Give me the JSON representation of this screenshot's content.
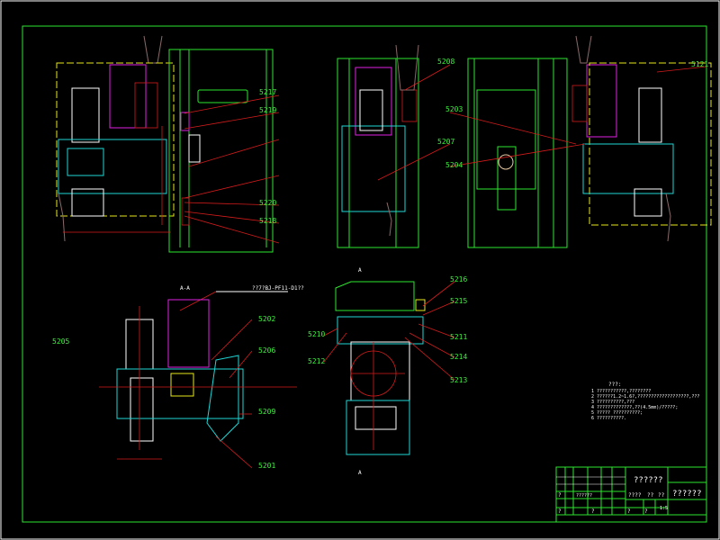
{
  "drawing": {
    "view_top_left_labels": [
      "5217",
      "5219",
      "5220",
      "5218"
    ],
    "view_top_mid_labels": [
      "5208",
      "5207"
    ],
    "view_top_right_labels": [
      "5203",
      "5204",
      "5121"
    ],
    "section_title": "A-A",
    "section_marker": "A",
    "motor_label": "??7?BJ-PF11-D1??",
    "section_left_labels": [
      "5202",
      "5206",
      "5205",
      "5201",
      "5209"
    ],
    "section_right_labels": [
      "5216",
      "5215",
      "5211",
      "5214",
      "5213",
      "5210",
      "5212"
    ],
    "notes_title": "???:",
    "notes": [
      "1 ???????????,????????",
      "2 ??????1.2~1.6?,???????????????????,???",
      "3 ??????????,???",
      "4 ?????????????,??(4.5mm)/?????;",
      "5 ????? ??????????;",
      "6 ??????????."
    ]
  },
  "title_block": {
    "drawing_name": "??????",
    "company": "??????",
    "cells": [
      "????",
      "??",
      "??",
      "1:5",
      "?",
      "?",
      "?",
      "?",
      "?",
      "??????"
    ]
  },
  "colors": {
    "border": "#2ee62e",
    "leader": "#d41c1c",
    "background": "#000000"
  }
}
